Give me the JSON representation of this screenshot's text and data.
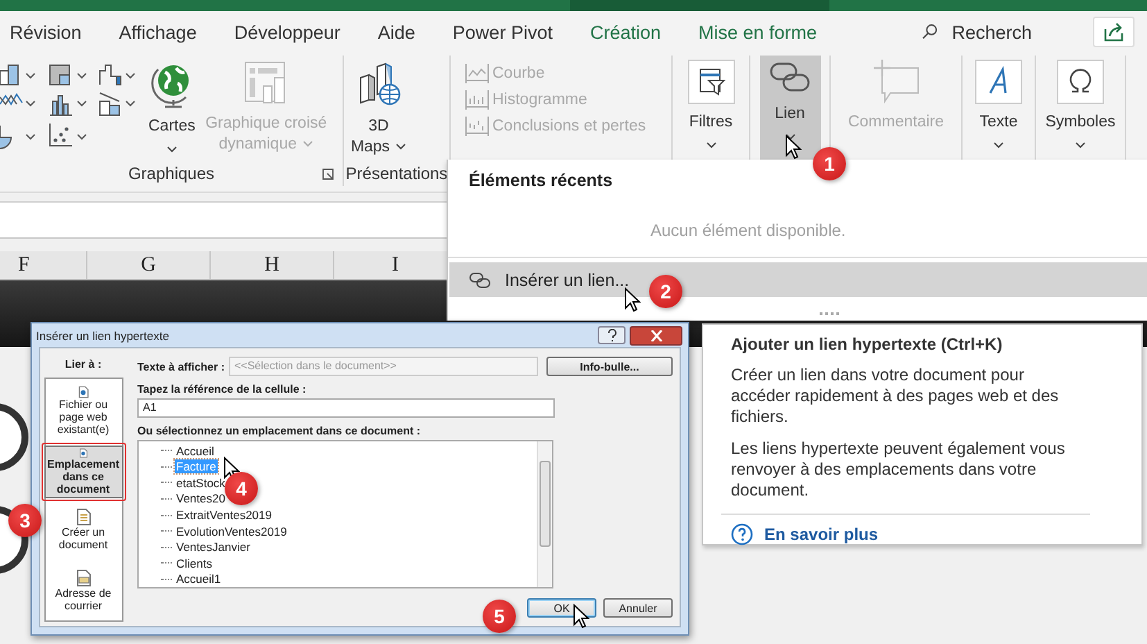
{
  "tabs": [
    {
      "label": "Révision",
      "contextual": false
    },
    {
      "label": "Affichage",
      "contextual": false
    },
    {
      "label": "Développeur",
      "contextual": false
    },
    {
      "label": "Aide",
      "contextual": false
    },
    {
      "label": "Power Pivot",
      "contextual": false
    },
    {
      "label": "Création",
      "contextual": true
    },
    {
      "label": "Mise en forme",
      "contextual": true
    }
  ],
  "search": {
    "placeholder": "Recherch"
  },
  "ribbon": {
    "groups": [
      {
        "label": "Graphiques",
        "buttons": [
          {
            "label": "Cartes",
            "disabled": false,
            "menu": true
          },
          {
            "label": "Graphique croisé dynamique",
            "disabled": true,
            "menu": true
          }
        ]
      },
      {
        "label": "Présentations",
        "buttons": [
          {
            "label": "3D Maps",
            "disabled": false,
            "menu": true
          }
        ]
      },
      {
        "buttons": [
          {
            "label": "Courbe",
            "disabled": true
          },
          {
            "label": "Histogramme",
            "disabled": true
          },
          {
            "label": "Conclusions et pertes",
            "disabled": true
          }
        ]
      },
      {
        "buttons": [
          {
            "label": "Filtres",
            "disabled": false,
            "pressed": false,
            "menu": true
          }
        ]
      },
      {
        "buttons": [
          {
            "label": "Lien",
            "disabled": false,
            "pressed": true,
            "menu": true
          }
        ]
      },
      {
        "buttons": [
          {
            "label": "Commentaire",
            "disabled": true,
            "pressed": false,
            "menu": false
          }
        ]
      },
      {
        "buttons": [
          {
            "label": "Texte",
            "disabled": false,
            "pressed": false,
            "menu": true
          }
        ]
      },
      {
        "buttons": [
          {
            "label": "Symboles",
            "disabled": false,
            "pressed": false,
            "menu": true
          }
        ]
      }
    ]
  },
  "sheet": {
    "columns": [
      "F",
      "G",
      "H",
      "I"
    ]
  },
  "link_menu": {
    "header": "Éléments récents",
    "empty_text": "Aucun élément disponible.",
    "items": [
      {
        "label": "Insérer un lien...",
        "selected": true
      }
    ]
  },
  "tooltip": {
    "title": "Ajouter un lien hypertexte (Ctrl+K)",
    "paragraphs": [
      "Créer un lien dans votre document pour accéder rapidement à des pages web et des fichiers.",
      "Les liens hypertexte peuvent également vous renvoyer à des emplacements dans votre document."
    ],
    "link": "En savoir plus"
  },
  "dialog": {
    "title": "Insérer un lien hypertexte",
    "link_to_label": "Lier à :",
    "link_targets": [
      {
        "label": "Fichier ou page web existant(e)",
        "selected": false
      },
      {
        "label": "Emplacement dans ce document",
        "selected": true
      },
      {
        "label": "Créer un document",
        "selected": false
      },
      {
        "label": "Adresse de courrier",
        "selected": false
      }
    ],
    "display_text": {
      "label": "Texte à afficher :",
      "value": "<<Sélection dans le document>>",
      "disabled": true
    },
    "screentip_button": "Info-bulle...",
    "cell_reference": {
      "label": "Tapez la référence de la cellule :",
      "value": "A1"
    },
    "places": {
      "label": "Ou sélectionnez un emplacement dans ce document :",
      "items": [
        {
          "label": "Accueil",
          "selected": false
        },
        {
          "label": "Facture",
          "selected": true
        },
        {
          "label": "etatStock",
          "selected": false
        },
        {
          "label": "Ventes20",
          "selected": false
        },
        {
          "label": "ExtraitVentes2019",
          "selected": false
        },
        {
          "label": "EvolutionVentes2019",
          "selected": false
        },
        {
          "label": "VentesJanvier",
          "selected": false
        },
        {
          "label": "Clients",
          "selected": false
        },
        {
          "label": "Accueil1",
          "selected": false
        }
      ]
    },
    "buttons": [
      {
        "label": "OK",
        "default": true
      },
      {
        "label": "Annuler",
        "default": false
      }
    ]
  },
  "callouts": [
    "1",
    "2",
    "3",
    "4",
    "5"
  ]
}
